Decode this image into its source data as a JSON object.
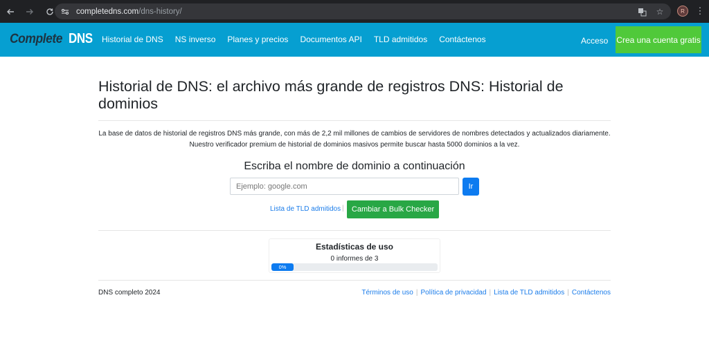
{
  "browser": {
    "url_host": "completedns.com",
    "url_path": "/dns-history/",
    "avatar_initial": "R"
  },
  "navbar": {
    "brand_part1": "Complete",
    "brand_part2": "DNS",
    "links": [
      "Historial de DNS",
      "NS inverso",
      "Planes y precios",
      "Documentos API",
      "TLD admitidos",
      "Contáctenos"
    ],
    "login_label": "Acceso",
    "signup_label": "Crea una cuenta gratis",
    "colors": {
      "bar": "#069fd1",
      "signup": "#50c93a"
    }
  },
  "main": {
    "title": "Historial de DNS: el archivo más grande de registros DNS: Historial de dominios",
    "intro_line1": "La base de datos de historial de registros DNS más grande, con más de 2,2 mil millones de cambios de servidores de nombres detectados y actualizados diariamente.",
    "intro_line2": "Nuestro verificador premium de historial de dominios masivos permite buscar hasta 5000 dominios a la vez.",
    "search_heading": "Escriba el nombre de dominio a continuación",
    "search_placeholder": "Ejemplo: google.com",
    "search_value": "",
    "go_label": "Ir",
    "tld_link_label": "Lista de TLD admitidos",
    "separator": "|",
    "bulk_label": "Cambiar a Bulk Checker"
  },
  "stats": {
    "title": "Estadísticas de uso",
    "count_text": "0 informes de 3",
    "progress_percent": 0,
    "progress_label": "0%"
  },
  "footer": {
    "copyright": "DNS completo 2024",
    "links": [
      "Términos de uso",
      "Política de privacidad",
      "Lista de TLD admitidos",
      "Contáctenos"
    ],
    "separator": "|"
  }
}
